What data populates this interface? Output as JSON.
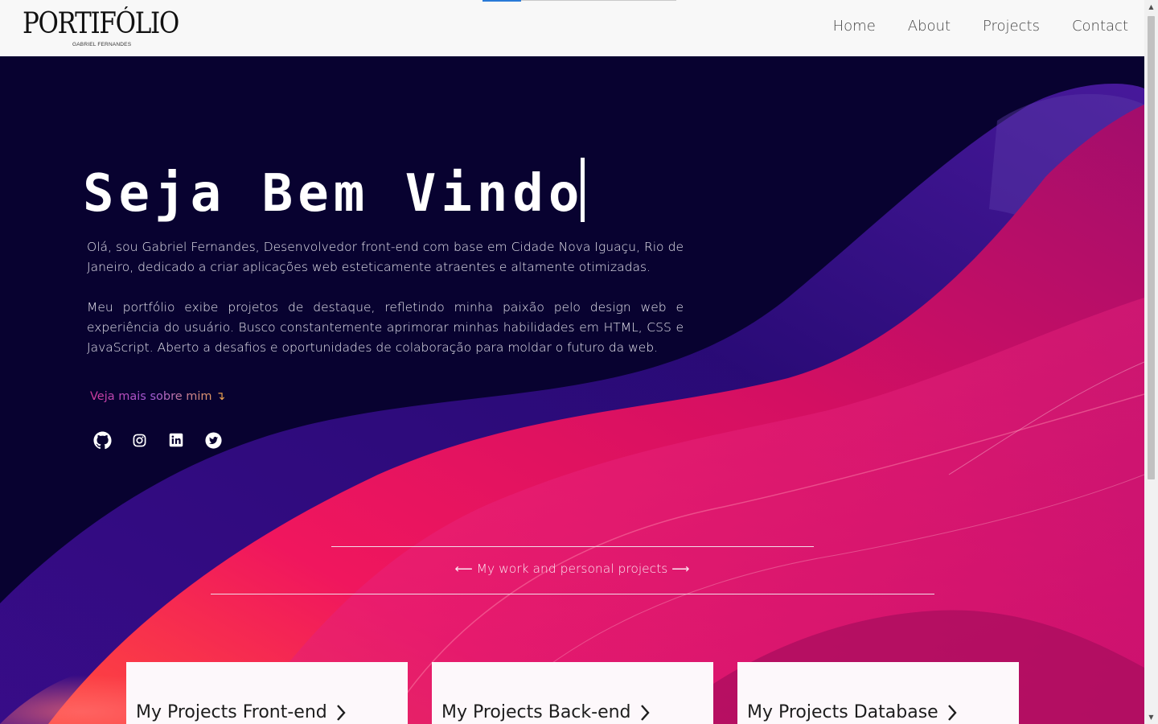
{
  "header": {
    "logo_title": "PORTIFÓLIO",
    "logo_subtitle": "GABRIEL FERNANDES",
    "progress_fraction": 0.2,
    "nav": [
      {
        "label": "Home"
      },
      {
        "label": "About"
      },
      {
        "label": "Projects"
      },
      {
        "label": "Contact"
      }
    ]
  },
  "hero": {
    "welcome_text": "Seja Bem Vindo",
    "paragraphs": [
      "Olá, sou Gabriel Fernandes, Desenvolvedor front-end com base em Cidade Nova Iguaçu, Rio de Janeiro, dedicado a criar aplicações web esteticamente atraentes e altamente otimizadas.",
      "Meu portfólio exibe projetos de destaque, refletindo minha paixão pelo design web e experiência do usuário. Busco constantemente aprimorar minhas habilidades em HTML, CSS e JavaScript. Aberto a desafios e oportunidades de colaboração para moldar o futuro da web."
    ],
    "more_link": "Veja mais sobre mim ↴",
    "socials": [
      {
        "icon": "github-icon"
      },
      {
        "icon": "instagram-icon"
      },
      {
        "icon": "linkedin-icon"
      },
      {
        "icon": "twitter-icon"
      }
    ]
  },
  "projects": {
    "caption": "⟵ My work and personal projects ⟶",
    "cards": [
      {
        "title": "My Projects Front-end"
      },
      {
        "title": "My Projects Back-end"
      },
      {
        "title": "My Projects Database"
      }
    ]
  },
  "colors": {
    "hero_bg": "#080230",
    "accent_pink": "#e8175d",
    "accent_purple": "#3a1a8a",
    "header_bg": "#f8f8f8"
  }
}
